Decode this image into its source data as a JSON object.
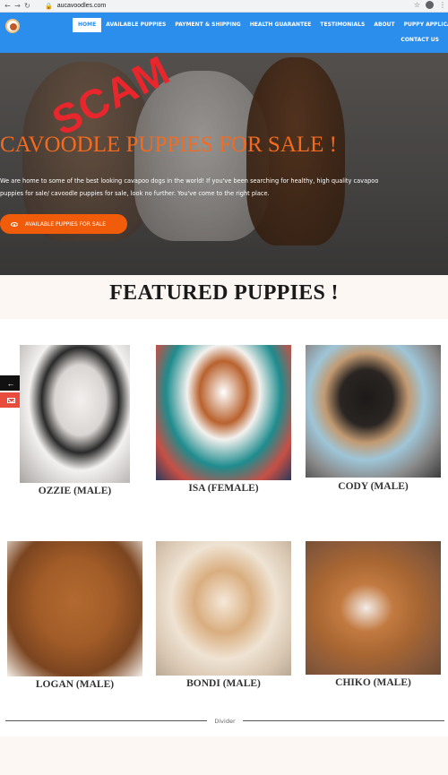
{
  "browser": {
    "url": "aucavoodles.com",
    "back_icon": "arrow-left",
    "forward_icon": "arrow-right",
    "reload_icon": "reload",
    "star_icon": "star",
    "profile_icon": "user",
    "menu_icon": "kebab"
  },
  "header": {
    "menu": [
      "HOME",
      "AVAILABLE PUPPIES",
      "PAYMENT & SHIPPING",
      "HEALTH GUARANTEE",
      "TESTIMONIALS",
      "ABOUT",
      "PUPPY APPLICATION"
    ],
    "contact": "CONTACT US",
    "active_index": 0,
    "bg_color": "#2b8eed"
  },
  "hero": {
    "scam_label": "SCAM",
    "title": "CAVOODLE PUPPIES FOR SALE !",
    "text": "We are home to some of the best looking cavapoo dogs in the world! If you've been searching for healthy, high quality cavapoo puppies for sale/ cavoodle puppies for sale, look no further. You've come to the right place.",
    "button": "AVAILABLE PUPPIES FOR SALE",
    "title_color": "#f46b1f",
    "button_color": "#f15c0b",
    "scam_color": "#e8262b"
  },
  "featured": {
    "title": "FEATURED PUPPIES !"
  },
  "side": {
    "arrow_icon": "arrow-left",
    "mail_icon": "envelope"
  },
  "puppies": [
    {
      "name": "OZZIE (MALE)"
    },
    {
      "name": "ISA (FEMALE)"
    },
    {
      "name": "CODY (MALE)"
    },
    {
      "name": "LOGAN (MALE)"
    },
    {
      "name": "BONDI (MALE)"
    },
    {
      "name": "CHIKO (MALE)"
    }
  ],
  "divider": {
    "label": "Divider"
  }
}
